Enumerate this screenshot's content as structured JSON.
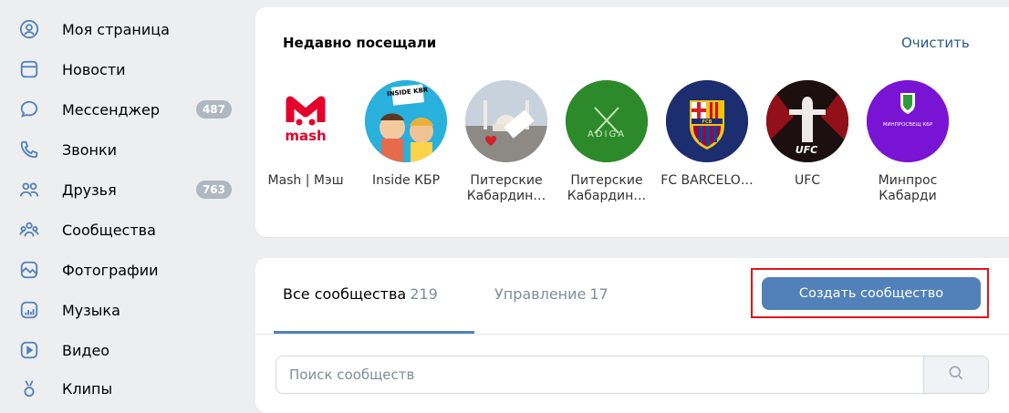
{
  "sidebar": {
    "items": [
      {
        "label": "Моя страница",
        "icon": "user-circle-icon"
      },
      {
        "label": "Новости",
        "icon": "news-icon"
      },
      {
        "label": "Мессенджер",
        "icon": "message-icon",
        "badge": "487"
      },
      {
        "label": "Звонки",
        "icon": "phone-icon"
      },
      {
        "label": "Друзья",
        "icon": "friends-icon",
        "badge": "763"
      },
      {
        "label": "Сообщества",
        "icon": "communities-icon"
      },
      {
        "label": "Фотографии",
        "icon": "photo-icon"
      },
      {
        "label": "Музыка",
        "icon": "music-icon"
      },
      {
        "label": "Видео",
        "icon": "video-icon"
      },
      {
        "label": "Клипы",
        "icon": "clips-icon"
      }
    ]
  },
  "recent": {
    "title": "Недавно посещали",
    "clear_label": "Очистить",
    "items": [
      {
        "name": "Mash | Мэш",
        "logo_text": "mash"
      },
      {
        "name": "Inside КБР",
        "logo_text": "INSIDE KBR"
      },
      {
        "name": "Питерские Кабардин…"
      },
      {
        "name": "Питерские Кабардин…",
        "logo_text": "ADIGA"
      },
      {
        "name": "FC BARCELO…",
        "logo_text": "FCB"
      },
      {
        "name": "UFC",
        "logo_text": "UFC"
      },
      {
        "name": "Минпрос Кабарди",
        "logo_text": "МИНПРОСВЕЩ КБР"
      }
    ]
  },
  "communities": {
    "tabs": [
      {
        "label": "Все сообщества",
        "count": "219"
      },
      {
        "label": "Управление",
        "count": "17"
      }
    ],
    "create_label": "Создать сообщество",
    "search_placeholder": "Поиск сообществ"
  },
  "colors": {
    "accent": "#5181b8",
    "highlight_outline": "#e0161a",
    "badge": "#aeb7c2",
    "link": "#2a5885"
  }
}
